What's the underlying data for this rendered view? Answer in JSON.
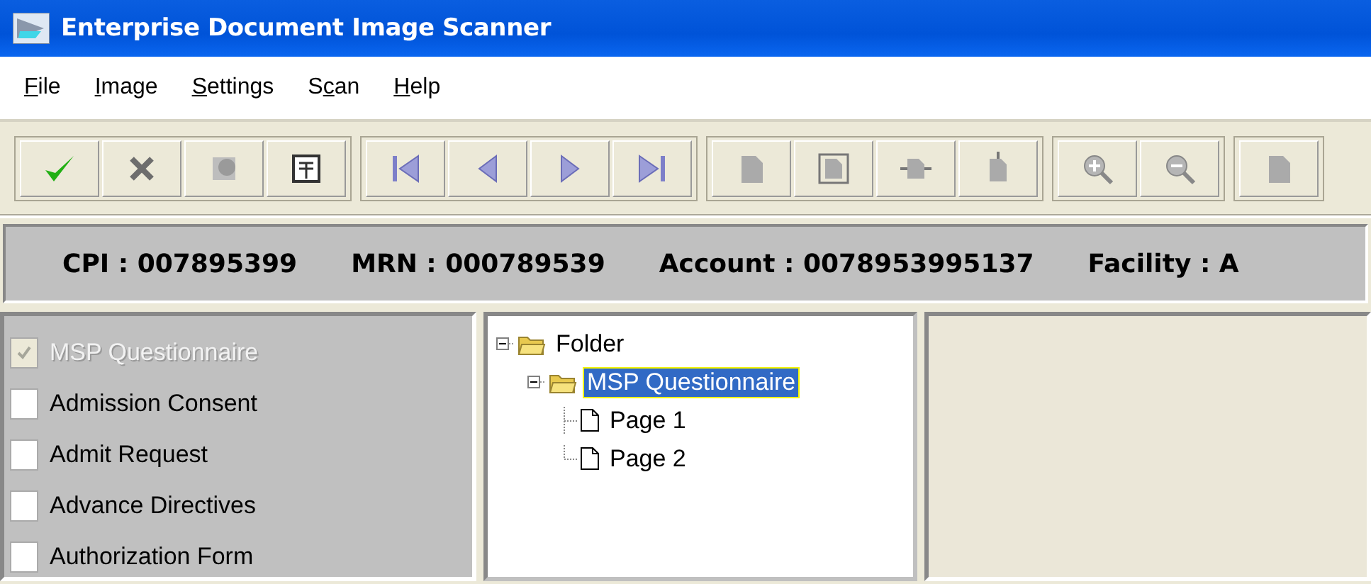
{
  "window": {
    "title": "Enterprise Document Image Scanner"
  },
  "menu": [
    {
      "label": "File"
    },
    {
      "label": "Image"
    },
    {
      "label": "Settings"
    },
    {
      "label": "Scan"
    },
    {
      "label": "Help"
    }
  ],
  "info_bar": [
    "CPI : 007895399",
    "MRN : 000789539",
    "Account : 0078953995137",
    "Facility : A"
  ],
  "document_types": [
    {
      "label": "MSP Questionnaire",
      "checked": true,
      "disabled": true
    },
    {
      "label": "Admission Consent",
      "checked": false,
      "disabled": false
    },
    {
      "label": "Admit Request",
      "checked": false,
      "disabled": false
    },
    {
      "label": "Advance Directives",
      "checked": false,
      "disabled": false
    },
    {
      "label": "Authorization Form",
      "checked": false,
      "disabled": false
    }
  ],
  "tree": [
    {
      "label": "Folder",
      "kind": "folder",
      "expanded": true,
      "selected": false,
      "children": [
        {
          "label": "MSP Questionnaire",
          "kind": "folder",
          "expanded": true,
          "selected": true,
          "children": [
            {
              "label": "Page 1",
              "kind": "page",
              "selected": false
            },
            {
              "label": "Page 2",
              "kind": "page",
              "selected": false
            }
          ]
        }
      ]
    }
  ]
}
